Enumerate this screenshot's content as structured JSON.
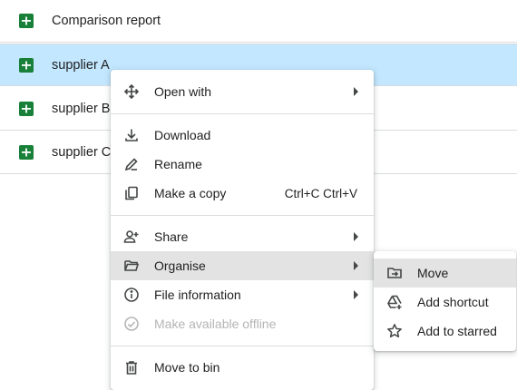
{
  "files": [
    {
      "name": "Comparison report"
    },
    {
      "name": "supplier A"
    },
    {
      "name": "supplier B"
    },
    {
      "name": "supplier C"
    }
  ],
  "context_menu": {
    "open_with": "Open with",
    "download": "Download",
    "rename": "Rename",
    "make_copy": "Make a copy",
    "make_copy_shortcut": "Ctrl+C Ctrl+V",
    "share": "Share",
    "organise": "Organise",
    "file_information": "File information",
    "make_available_offline": "Make available offline",
    "move_to_bin": "Move to bin"
  },
  "submenu": {
    "move": "Move",
    "add_shortcut": "Add shortcut",
    "add_to_starred": "Add to starred"
  },
  "colors": {
    "sheets_green": "#188038",
    "selected_row": "#c2e7ff",
    "menu_hover": "#e3e3e3",
    "icon": "#444746",
    "disabled": "#b5b5b5"
  }
}
